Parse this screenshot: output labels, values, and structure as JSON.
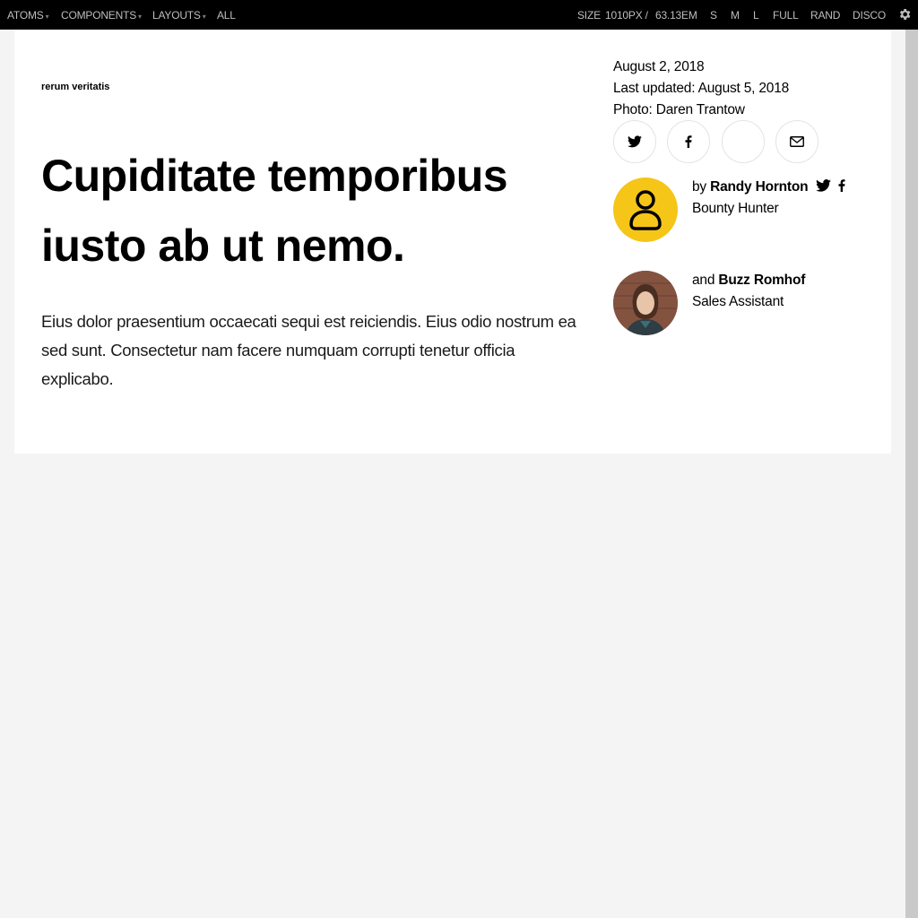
{
  "toolbar": {
    "nav": [
      {
        "label": "ATOMS",
        "has_caret": true
      },
      {
        "label": "COMPONENTS",
        "has_caret": true
      },
      {
        "label": "LAYOUTS",
        "has_caret": true
      },
      {
        "label": "ALL",
        "has_caret": false
      }
    ],
    "size_label": "SIZE",
    "size_px": "1010PX /",
    "size_em": "63.13EM",
    "sizes": [
      "S",
      "M",
      "L",
      "FULL",
      "RAND",
      "DISCO"
    ],
    "caret": "▾",
    "settings_icon": "gear-icon"
  },
  "article": {
    "kicker": "rerum veritatis",
    "headline": "Cupiditate temporibus iusto ab ut nemo.",
    "dek": "Eius dolor praesentium occaecati sequi est reiciendis. Eius odio nostrum ea sed sunt. Consectetur nam facere numquam corrupti tenetur officia explicabo.",
    "date": "August 2, 2018",
    "updated": "Last updated: August 5, 2018",
    "photo_credit": "Photo: Daren Trantow",
    "share": [
      {
        "icon": "twitter-icon"
      },
      {
        "icon": "facebook-icon"
      },
      {
        "icon": "blank-share-icon"
      },
      {
        "icon": "email-icon"
      }
    ],
    "authors": [
      {
        "prefix": "by",
        "name": "Randy Hornton",
        "role": "Bounty Hunter",
        "avatar": "person-placeholder-icon",
        "avatar_color": "#f5c518",
        "socials": [
          "twitter-icon",
          "facebook-icon"
        ]
      },
      {
        "prefix": "and",
        "name": "Buzz Romhof",
        "role": "Sales Assistant",
        "avatar": "photo-avatar",
        "socials": []
      }
    ]
  }
}
